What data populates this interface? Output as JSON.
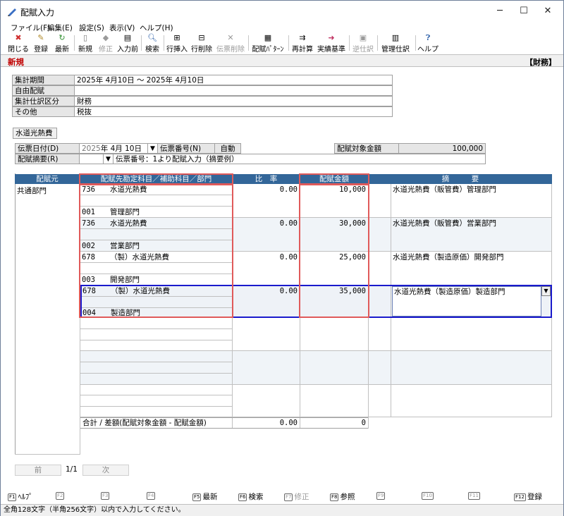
{
  "window": {
    "title": "配賦入力",
    "minimize": "─",
    "maximize": "☐",
    "close": "✕"
  },
  "menu": [
    "ファイル(F)",
    "編集(E)",
    "設定(S)",
    "表示(V)",
    "ヘルプ(H)"
  ],
  "toolbar": {
    "close": "閉じる",
    "register": "登録",
    "refresh": "最新",
    "new": "新規",
    "modify": "修正",
    "input_prev": "入力前",
    "search": "検索",
    "row_insert": "行挿入",
    "row_delete": "行削除",
    "slip_delete": "伝票削除",
    "pattern": "配賦ﾊﾟﾀｰﾝ",
    "recalc": "再計算",
    "actual_base": "実績基準",
    "reverse": "逆仕訳",
    "mgmt": "管理仕訳",
    "help": "ヘルプ"
  },
  "mode": "新規",
  "account_label": "【財務】",
  "info": [
    {
      "label": "集計期間",
      "value": "2025年 4月10日 〜 2025年 4月10日"
    },
    {
      "label": "自由配賦",
      "value": ""
    },
    {
      "label": "集計仕訳区分",
      "value": "財務"
    },
    {
      "label": "その他",
      "value": "税抜"
    }
  ],
  "section_title": "水道光熱費",
  "slip": {
    "date_label": "伝票日付(D)",
    "date_year": "2025",
    "date_rest": "年  4月 10日",
    "number_label": "伝票番号(N)",
    "number_value": "自動",
    "target_label": "配賦対象金額",
    "target_value": "100,000",
    "summary_label": "配賦摘要(R)",
    "summary_value": "伝票番号：1より配賦入力（摘要例）"
  },
  "grid": {
    "headers": {
      "source": "配賦元",
      "dest": "配賦先勘定科目／補助科目／部門",
      "ratio": "比　率",
      "amount": "配賦金額",
      "memo": "摘　　　要"
    },
    "source_value": "共通部門",
    "rows": [
      {
        "acct_code": "736",
        "acct_name": "水道光熱費",
        "dept_code": "001",
        "dept_name": "管理部門",
        "ratio": "0.00",
        "amount": "10,000",
        "memo": "水道光熱費（販管費）管理部門"
      },
      {
        "acct_code": "736",
        "acct_name": "水道光熱費",
        "dept_code": "002",
        "dept_name": "営業部門",
        "ratio": "0.00",
        "amount": "30,000",
        "memo": "水道光熱費（販管費）営業部門"
      },
      {
        "acct_code": "678",
        "acct_name": "（製）水道光熱費",
        "dept_code": "003",
        "dept_name": "開発部門",
        "ratio": "0.00",
        "amount": "25,000",
        "memo": "水道光熱費（製造原価）開発部門"
      },
      {
        "acct_code": "678",
        "acct_name": "（製）水道光熱費",
        "dept_code": "004",
        "dept_name": "製造部門",
        "ratio": "0.00",
        "amount": "35,000",
        "memo": "水道光熱費（製造原価）製造部門"
      }
    ],
    "total_label": "合計 / 差額(配賦対象金額 - 配賦金額)",
    "total_ratio": "0.00",
    "total_amount": "0"
  },
  "nav": {
    "prev": "前",
    "page": "1/1",
    "next": "次"
  },
  "fkeys": [
    {
      "key": "F1",
      "label": "ﾍﾙﾌﾟ",
      "enabled": true
    },
    {
      "key": "F2",
      "label": "",
      "enabled": false
    },
    {
      "key": "F3",
      "label": "",
      "enabled": false
    },
    {
      "key": "F4",
      "label": "",
      "enabled": false
    },
    {
      "key": "F5",
      "label": "最新",
      "enabled": true
    },
    {
      "key": "F6",
      "label": "検索",
      "enabled": true
    },
    {
      "key": "F7",
      "label": "修正",
      "enabled": false
    },
    {
      "key": "F8",
      "label": "参照",
      "enabled": true
    },
    {
      "key": "F9",
      "label": "",
      "enabled": false
    },
    {
      "key": "F10",
      "label": "",
      "enabled": false
    },
    {
      "key": "F11",
      "label": "",
      "enabled": false
    },
    {
      "key": "F12",
      "label": "登録",
      "enabled": true
    }
  ],
  "status": "全角128文字（半角256文字）以内で入力してください。",
  "colors": {
    "grid_header": "#336699",
    "highlight": "#e05a5a",
    "selected_row": "#0000cc",
    "mode_text": "#c00000"
  }
}
